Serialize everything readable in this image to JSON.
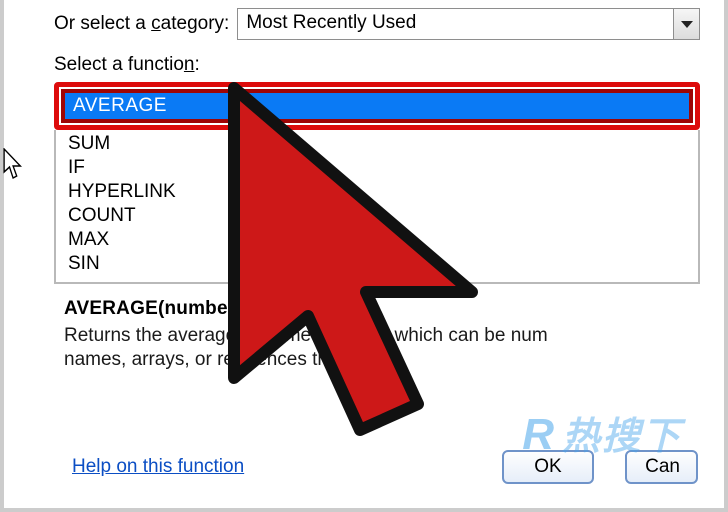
{
  "category": {
    "label_pre": "Or select a ",
    "label_hot": "c",
    "label_post": "ategory:",
    "selected": "Most Recently Used"
  },
  "select_fn": {
    "label_pre": "Select a functio",
    "label_hot": "n",
    "label_post": ":"
  },
  "functions": {
    "selected": "AVERAGE",
    "items": [
      "SUM",
      "IF",
      "HYPERLINK",
      "COUNT",
      "MAX",
      "SIN"
    ]
  },
  "description": {
    "signature": "AVERAGE(number1,numb",
    "text": "Returns the average (arithmet                                uments, which can be num\nnames, arrays, or references th                  tain"
  },
  "help_link": "Help on this function",
  "buttons": {
    "ok": "OK",
    "cancel": "Can"
  },
  "watermark": "热搜下"
}
